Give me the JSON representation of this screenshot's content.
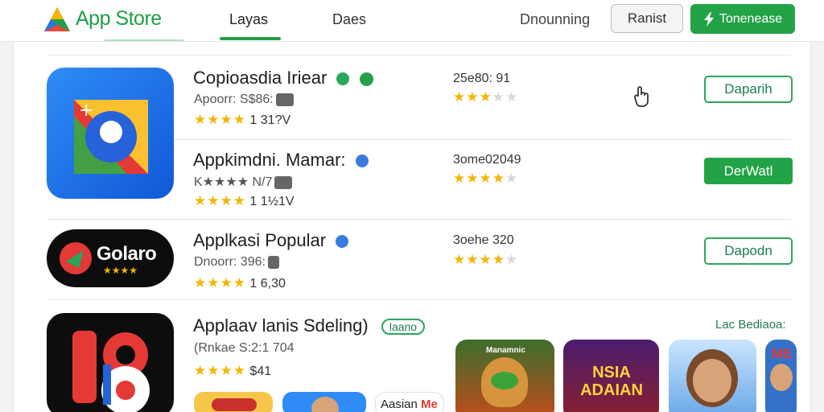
{
  "header": {
    "brand": "App Store",
    "tabs": [
      {
        "label": "Layas",
        "active": true
      },
      {
        "label": "Daes",
        "active": false
      }
    ],
    "link_label": "Dnounning",
    "secondary_button": "Ranist",
    "primary_button": "Tonenease",
    "accent": "#23a347"
  },
  "apps": [
    {
      "title": "Copioasdia Iriear",
      "sub": "Apoorr: S$86:",
      "rating_count": "1 31?V",
      "meta": "25e80: 91",
      "button": "Daparih",
      "button_style": "outline"
    },
    {
      "title": "Appkimdni. Mamar:",
      "sub": "K★★★★ N/7",
      "rating_count": "1 1½1V",
      "meta": "3ome02049",
      "button": "DerWatl",
      "button_style": "solid"
    },
    {
      "title": "Applkasi Popular",
      "sub": "Dnoorr: 396:",
      "rating_count": "1 6,30",
      "meta": "3oehe 320",
      "button": "Dapodn",
      "button_style": "outline",
      "icon_text": "Golaro"
    },
    {
      "title": "Applaav lanis Sdeling)",
      "pill": "laano",
      "sub": "(Rnkae S:2:1 704",
      "rating_count": "$41",
      "section_link": "Lac Bediaoa:"
    }
  ],
  "bottom_cards": {
    "third_label": "Aasian",
    "third_label_red": "Me"
  },
  "thumbnails": [
    {
      "text": "Manamnic",
      "name": "thumb-cartoon-dog"
    },
    {
      "text": "NSIA ADAIAN",
      "name": "thumb-adaian"
    },
    {
      "text": "",
      "name": "thumb-cartoon-girl"
    },
    {
      "text": "ME",
      "name": "thumb-boy"
    }
  ],
  "icons": [
    "app-store-logo",
    "bolt-icon",
    "hand-cursor-icon",
    "verified-badge-icon"
  ]
}
